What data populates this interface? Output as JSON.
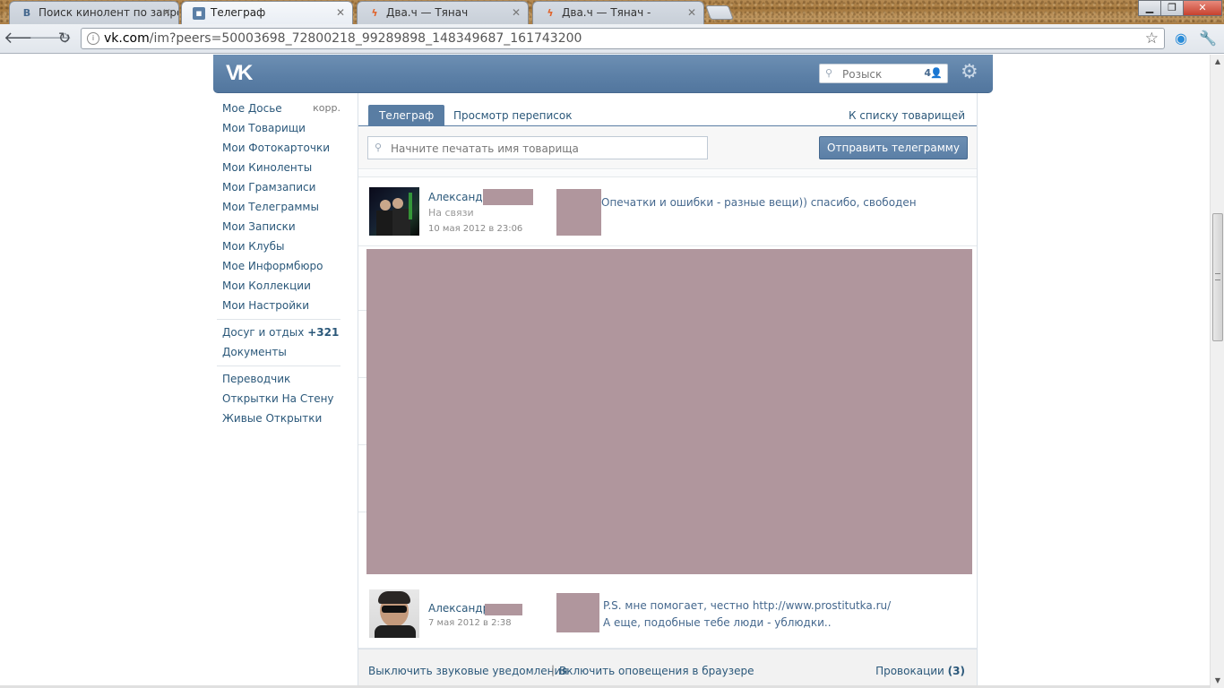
{
  "browser": {
    "tabs": [
      {
        "label": "Поиск кинолент по запрос",
        "icon": "vk-icon",
        "state": "inactive"
      },
      {
        "label": "Телеграф",
        "icon": "message-icon",
        "state": "active"
      },
      {
        "label": "Два.ч — Тянач",
        "icon": "bolt-icon",
        "state": "inactive"
      },
      {
        "label": "Два.ч — Тянач -",
        "icon": "bolt-icon",
        "state": "inactive"
      }
    ],
    "url_host": "vk.com",
    "url_path": "/im?peers=50003698_72800218_99289898_148349687_161743200",
    "window_controls": {
      "minimize": "▁",
      "restore": "❐",
      "close": "✕"
    }
  },
  "header": {
    "logo": "VK",
    "search_placeholder": "Розыск",
    "online_count": "4"
  },
  "sidebar": {
    "primary": [
      {
        "label": "Мое Досье",
        "extra": "корр."
      },
      {
        "label": "Мои Товарищи"
      },
      {
        "label": "Мои Фотокарточки"
      },
      {
        "label": "Мои Киноленты"
      },
      {
        "label": "Мои Грамзаписи"
      },
      {
        "label": "Мои Телеграммы"
      },
      {
        "label": "Мои Записки"
      },
      {
        "label": "Мои Клубы"
      },
      {
        "label": "Мое Информбюро"
      },
      {
        "label": "Мои Коллекции"
      },
      {
        "label": "Мои Настройки"
      }
    ],
    "secondary": [
      {
        "label": "Досуг и отдых",
        "count": "+321"
      },
      {
        "label": "Документы"
      }
    ],
    "apps": [
      {
        "label": "Переводчик"
      },
      {
        "label": "Открытки На Стену"
      },
      {
        "label": "Живые Открытки"
      }
    ]
  },
  "im": {
    "tabs": {
      "active": "Телеграф",
      "second": "Просмотр переписок",
      "right": "К списку товарищей"
    },
    "friend_input_placeholder": "Начните печатать имя товарища",
    "send_button": "Отправить телеграмму",
    "messages": [
      {
        "author": "Александр",
        "status": "На связи",
        "date": "10 мая 2012 в 23:06",
        "lines": [
          "Опечатки и ошибки - разные вещи)) спасибо, свободен"
        ]
      },
      {
        "author": "Александр",
        "status": "",
        "date": "7 мая 2012 в 2:38",
        "lines": [
          "P.S. мне помогает, честно http://www.prostitutka.ru/",
          "А еще, подобные тебе люди - ублюдки.."
        ]
      }
    ],
    "footer": {
      "sound_toggle": "Выключить звуковые уведомления",
      "separator": "|",
      "browser_notify": "Включить оповещения в браузере",
      "provocations_label": "Провокации",
      "provocations_count": "(3)"
    }
  },
  "colors": {
    "vk_blue": "#597da3",
    "link": "#2b587a",
    "redaction": "#b0969d"
  }
}
